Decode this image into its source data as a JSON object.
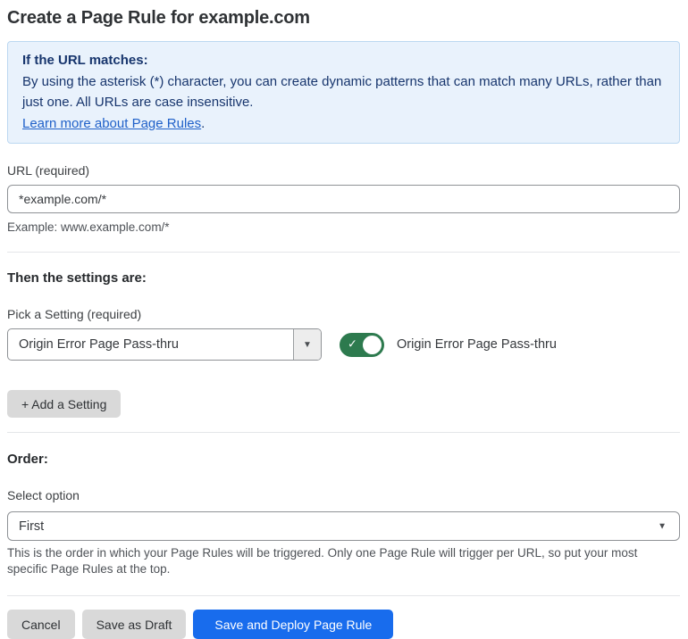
{
  "page": {
    "title": "Create a Page Rule for example.com"
  },
  "info_box": {
    "heading": "If the URL matches:",
    "body": "By using the asterisk (*) character, you can create dynamic patterns that can match many URLs, rather than just one. All URLs are case insensitive.",
    "link_label": "Learn more about Page Rules",
    "link_suffix": "."
  },
  "url_field": {
    "label": "URL (required)",
    "value": "*example.com/*",
    "helper": "Example: www.example.com/*"
  },
  "settings_section": {
    "heading": "Then the settings are:",
    "picker_label": "Pick a Setting (required)",
    "picker_value": "Origin Error Page Pass-thru",
    "toggle_label": "Origin Error Page Pass-thru",
    "toggle_state": "on",
    "add_button_label": "+ Add a Setting"
  },
  "order_section": {
    "heading": "Order:",
    "select_label": "Select option",
    "select_value": "First",
    "helper": "This is the order in which your Page Rules will be triggered. Only one Page Rule will trigger per URL, so put your most specific Page Rules at the top."
  },
  "footer": {
    "cancel_label": "Cancel",
    "save_draft_label": "Save as Draft",
    "save_deploy_label": "Save and Deploy Page Rule"
  },
  "colors": {
    "info_bg": "#e9f2fc",
    "info_border": "#bcd8f1",
    "info_text": "#17356d",
    "link_blue": "#2061c9",
    "toggle_on_green": "#2d7a4e",
    "primary_button_blue": "#186ced",
    "secondary_button_gray": "#d9d9d9"
  },
  "icons": {
    "dropdown_arrow": "▼",
    "select_arrow": "▼",
    "check": "✓"
  }
}
